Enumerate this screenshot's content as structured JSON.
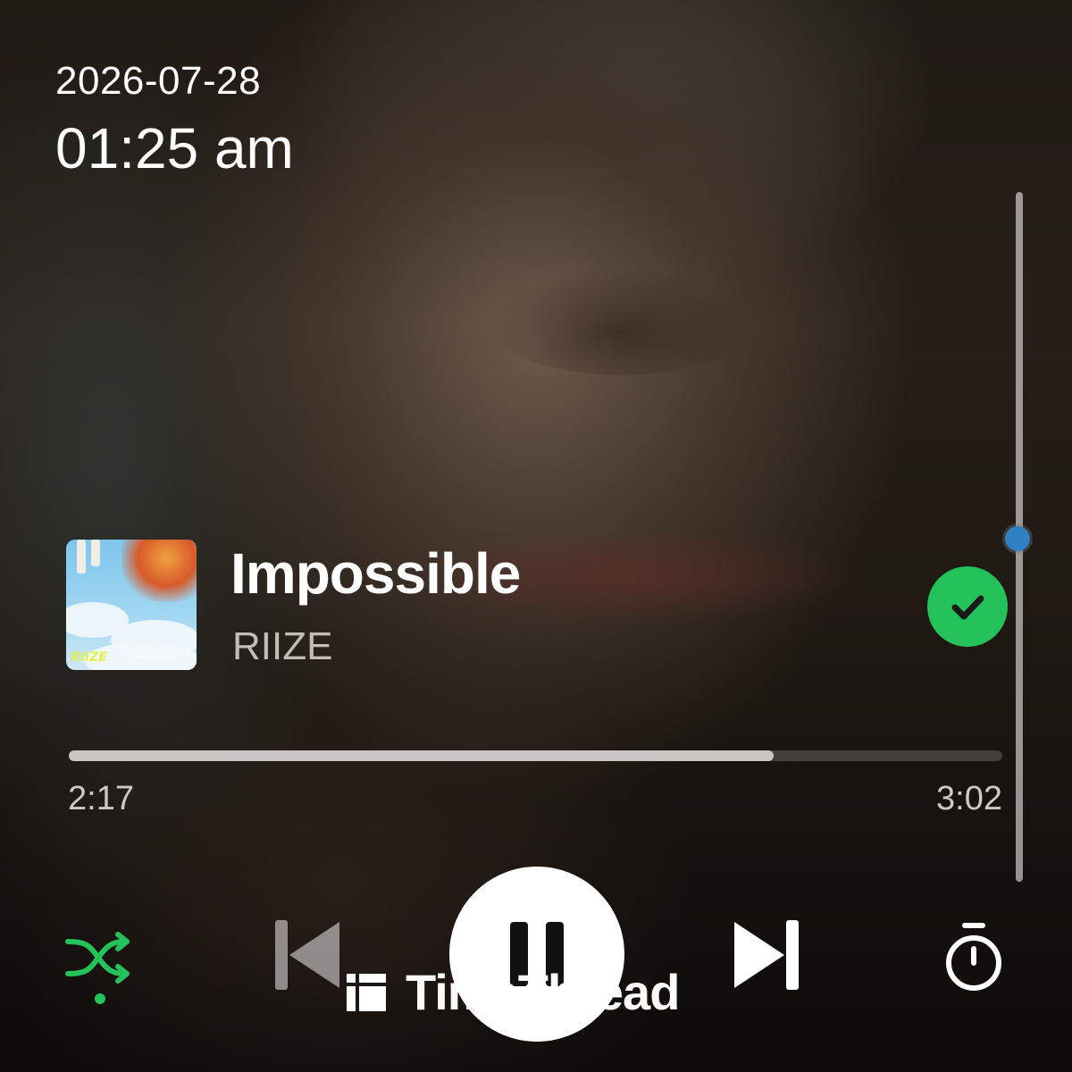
{
  "status": {
    "date": "2026-07-28",
    "time": "01:25 am"
  },
  "volume": {
    "level": 0.5
  },
  "track": {
    "title": "Impossible",
    "artist": "RIIZE",
    "album_art_text": "RIIZE",
    "liked": true
  },
  "playback": {
    "position": "2:17",
    "duration": "3:02",
    "progress_fraction": 0.755,
    "state": "playing"
  },
  "controls": {
    "shuffle_active": true,
    "icons": [
      "shuffle-icon",
      "previous-icon",
      "pause-icon",
      "next-icon",
      "sleep-timer-icon"
    ]
  },
  "watermark": {
    "text": "TimeThread"
  },
  "colors": {
    "accent": "#23c25b",
    "volume_knob": "#2f7fc3"
  }
}
